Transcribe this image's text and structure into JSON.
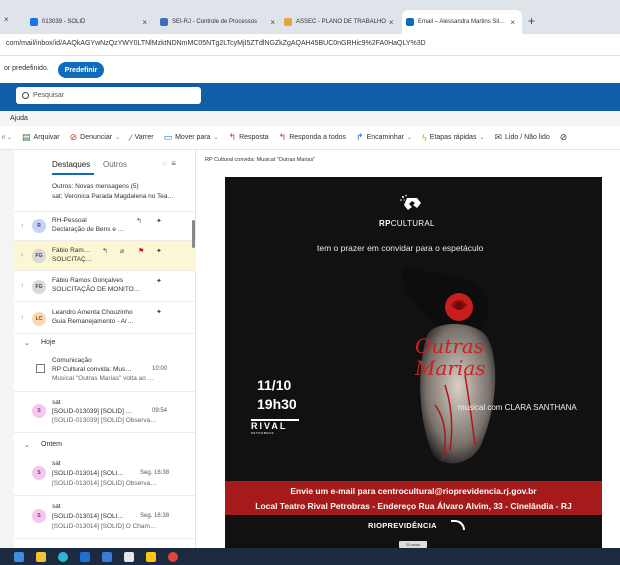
{
  "browser": {
    "tabs": [
      {
        "label": "013039 - SOLID",
        "color": "#1a73e8"
      },
      {
        "label": "SEI-RJ - Controle de Processos",
        "color": "#3b6fb6"
      },
      {
        "label": "ASSEC - PLANO DE TRABALHO",
        "color": "#e8a33d"
      },
      {
        "label": "Email – Alessandra Martins Sil…",
        "color": "#0f6cbd",
        "active": true
      }
    ],
    "new_tab": "+",
    "url": "com/mail/inbox/id/AAQkAGYwNzQzYWY0LTNlMzktNDNmMC05NTg2LTcyMjI5ZTdlNGZkZgAQAH45BUC0nGRHic9%2FA0HaQLY%3D"
  },
  "banner": {
    "text": "or predefinido.",
    "button": "Predefinir"
  },
  "search": {
    "placeholder": "Pesquisar"
  },
  "ribbon": {
    "menu_tab": "Ajuda",
    "actions": [
      {
        "label": "Arquivar",
        "icon": "archive-icon",
        "glyph": "🗃"
      },
      {
        "label": "Denunciar",
        "icon": "report-icon",
        "glyph": "⊘",
        "dropdown": true
      },
      {
        "label": "Varrer",
        "icon": "sweep-icon",
        "glyph": "🧹"
      },
      {
        "label": "Mover para",
        "icon": "move-icon",
        "glyph": "📁",
        "dropdown": true
      },
      {
        "label": "Resposta",
        "icon": "reply-icon",
        "glyph": "↩"
      },
      {
        "label": "Responda a todos",
        "icon": "reply-all-icon",
        "glyph": "↩"
      },
      {
        "label": "Encaminhar",
        "icon": "forward-icon",
        "glyph": "↪",
        "dropdown": true
      },
      {
        "label": "Etapas rápidas",
        "icon": "quick-steps-icon",
        "glyph": "⚡",
        "dropdown": true
      },
      {
        "label": "Lido / Não lido",
        "icon": "read-unread-icon",
        "glyph": "✉"
      }
    ]
  },
  "mail_list": {
    "tabs": [
      "Destaques",
      "Outros"
    ],
    "others_notice": {
      "title": "Outros: Novas mensagens (5)",
      "preview": "sat; Veronica Parada Magdalena no Tea…"
    },
    "items": [
      {
        "initials": "R",
        "av_color": "#c8d2f5",
        "av_text": "#2d3d8a",
        "sender": "RH-Pessoal",
        "subject": "Declaração de Bens e …",
        "flag": false,
        "highlight": false
      },
      {
        "initials": "FG",
        "av_color": "#d9d9d9",
        "av_text": "#444",
        "sender": "Fábio Ram…",
        "subject": "SOLICITAÇ…",
        "flag": true,
        "highlight": true
      },
      {
        "initials": "FG",
        "av_color": "#d9d9d9",
        "av_text": "#444",
        "sender": "Fábio Ramos Gonçalves",
        "subject": "SOLICITAÇÃO DE MONITO…",
        "flag": false,
        "highlight": false
      },
      {
        "initials": "LC",
        "av_color": "#fbd9b0",
        "av_text": "#8a4b10",
        "sender": "Leandro Amenta Chouzinho",
        "subject": "Guia Remanejamento - Ar…",
        "flag": false,
        "highlight": false
      }
    ],
    "group_today": "Hoje",
    "today_items": [
      {
        "sender": "Comunicação",
        "subject": "RP Cultural convida: Mus…",
        "time": "10:00",
        "preview": "Musical \"Outras Marias\" volta ao …",
        "checkbox": true
      },
      {
        "initials": "S",
        "av_color": "#f3c8ee",
        "av_text": "#8a2b84",
        "sender": "sat",
        "subject": "[SOLID-013039] [SOLID] …",
        "time": "09:54",
        "preview": "[SOLID-013039] [SOLID] Observa…"
      }
    ],
    "group_older": "Ontem",
    "older_items": [
      {
        "initials": "S",
        "av_color": "#f3c8ee",
        "av_text": "#8a2b84",
        "sender": "sat",
        "subject": "[SOLID-013014] [SOLI…",
        "time": "Seg. 16:38",
        "preview": "[SOLID-013014] [SOLID] Observa…"
      },
      {
        "initials": "S",
        "av_color": "#f3c8ee",
        "av_text": "#8a2b84",
        "sender": "sat",
        "subject": "[SOLID-013014] [SOLI…",
        "time": "Seg. 16:38",
        "preview": "[SOLID-013014] [SOLID] O Cham…"
      }
    ]
  },
  "reading": {
    "subject": "RP Cultural convida: Musical \"Outras Marias\"",
    "poster": {
      "brand_bold": "RP",
      "brand_rest": "CULTURAL",
      "invite": "tem o prazer em convidar para o espetáculo",
      "title_line1": "Outras",
      "title_line2": "Marias",
      "date": "11/10",
      "time": "19h30",
      "venue_logo": "RIVAL",
      "venue_sub": "PETROBRAS",
      "musical": "musical com CLARA SANTHANA",
      "email": "Envie um e-mail para centrocultural@rioprevidencia.rj.gov.br",
      "place": "Local Teatro Rival Petrobras  - Endereço Rua Álvaro Alvim, 33  - Cinelândia - RJ",
      "footer_logo": "RIOPREVIDÊNCIA",
      "footer_badge": "20 anos"
    }
  },
  "colors": {
    "outlook_blue": "#0f5ea8",
    "accent": "#0f6cbd",
    "flag_red": "#c50f1f",
    "poster_red": "#a51a1a"
  },
  "taskbar": {
    "apps": [
      {
        "name": "start-icon",
        "color": "#3a8ee6"
      },
      {
        "name": "file-explorer-icon",
        "color": "#f1c232"
      },
      {
        "name": "edge-icon",
        "color": "#2fb5d6"
      },
      {
        "name": "outlook-icon",
        "color": "#1f6fd1"
      },
      {
        "name": "word-icon",
        "color": "#3c78d8"
      },
      {
        "name": "calendar-icon",
        "color": "#e6e6e6"
      },
      {
        "name": "sticky-icon",
        "color": "#f9c80e"
      },
      {
        "name": "chrome-icon",
        "color": "#e0443a"
      }
    ]
  }
}
